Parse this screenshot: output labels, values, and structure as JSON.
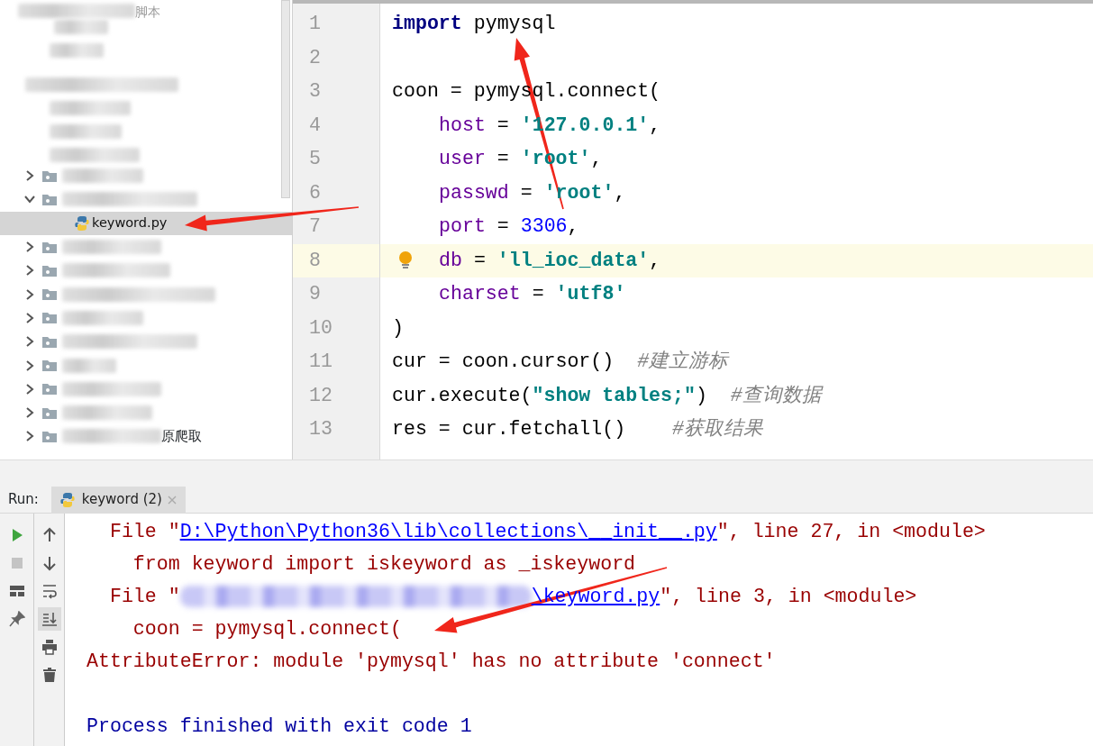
{
  "project_tree": {
    "top_label": "脚本",
    "items": [
      {
        "label_blurred": true,
        "expanded": false,
        "selected": false
      },
      {
        "label_blurred": true,
        "expanded": true,
        "selected": false,
        "children": [
          {
            "label": "keyword.py",
            "selected": true
          }
        ]
      },
      {
        "label_blurred": true,
        "expanded": false,
        "selected": false
      },
      {
        "label_blurred": true,
        "expanded": false,
        "selected": false
      },
      {
        "label_blurred": true,
        "expanded": false,
        "selected": false
      },
      {
        "label_blurred": true,
        "expanded": false,
        "selected": false
      },
      {
        "label_blurred": true,
        "expanded": false,
        "selected": false
      },
      {
        "label_blurred": true,
        "expanded": false,
        "selected": false
      },
      {
        "label_blurred": true,
        "expanded": false,
        "selected": false
      },
      {
        "label_blurred": true,
        "expanded": false,
        "selected": false
      },
      {
        "label_blurred": true,
        "label": "原爬取",
        "expanded": false,
        "selected": false
      }
    ]
  },
  "editor": {
    "lines": [
      {
        "number": "1",
        "current": false,
        "bulb": false,
        "indented": false,
        "tokens": [
          {
            "kind": "keyword",
            "text": "import"
          },
          {
            "kind": "plain",
            "text": " pymysql"
          }
        ]
      },
      {
        "number": "2",
        "current": false,
        "bulb": false
      },
      {
        "number": "3",
        "current": false,
        "bulb": false,
        "indented": false,
        "tokens": [
          {
            "kind": "plain",
            "text": "coon = pymysql.connect("
          }
        ]
      },
      {
        "number": "4",
        "current": false,
        "bulb": false,
        "indented": true,
        "tokens": [
          {
            "kind": "param",
            "text": "host"
          },
          {
            "kind": "plain",
            "text": " = "
          },
          {
            "kind": "string",
            "text": "'127.0.0.1'"
          },
          {
            "kind": "plain",
            "text": ","
          }
        ]
      },
      {
        "number": "5",
        "current": false,
        "bulb": false,
        "indented": true,
        "tokens": [
          {
            "kind": "param",
            "text": "user"
          },
          {
            "kind": "plain",
            "text": " = "
          },
          {
            "kind": "string",
            "text": "'root'"
          },
          {
            "kind": "plain",
            "text": ","
          }
        ]
      },
      {
        "number": "6",
        "current": false,
        "bulb": false,
        "indented": true,
        "tokens": [
          {
            "kind": "param",
            "text": "passwd"
          },
          {
            "kind": "plain",
            "text": " = "
          },
          {
            "kind": "string",
            "text": "'root'"
          },
          {
            "kind": "plain",
            "text": ","
          }
        ]
      },
      {
        "number": "7",
        "current": false,
        "bulb": false,
        "indented": true,
        "tokens": [
          {
            "kind": "param",
            "text": "port"
          },
          {
            "kind": "plain",
            "text": " = "
          },
          {
            "kind": "number",
            "text": "3306"
          },
          {
            "kind": "plain",
            "text": ","
          }
        ]
      },
      {
        "number": "8",
        "current": true,
        "bulb": true,
        "indented": true,
        "tokens": [
          {
            "kind": "param",
            "text": "db"
          },
          {
            "kind": "plain",
            "text": " = "
          },
          {
            "kind": "string",
            "text": "'ll_ioc_data'"
          },
          {
            "kind": "plain",
            "text": ","
          }
        ]
      },
      {
        "number": "9",
        "current": false,
        "bulb": false,
        "indented": true,
        "tokens": [
          {
            "kind": "param",
            "text": "charset"
          },
          {
            "kind": "plain",
            "text": " = "
          },
          {
            "kind": "string",
            "text": "'utf8'"
          }
        ]
      },
      {
        "number": "10",
        "current": false,
        "bulb": false,
        "indented": false,
        "tokens": [
          {
            "kind": "plain",
            "text": ")"
          }
        ]
      },
      {
        "number": "11",
        "current": false,
        "bulb": false,
        "indented": false,
        "tokens": [
          {
            "kind": "plain",
            "text": "cur = coon.cursor()  "
          },
          {
            "kind": "comment",
            "text": "#建立游标"
          }
        ]
      },
      {
        "number": "12",
        "current": false,
        "bulb": false,
        "indented": false,
        "tokens": [
          {
            "kind": "plain",
            "text": "cur.execute("
          },
          {
            "kind": "string",
            "text": "\"show tables;\""
          },
          {
            "kind": "plain",
            "text": ")  "
          },
          {
            "kind": "comment",
            "text": "#查询数据"
          }
        ]
      },
      {
        "number": "13",
        "current": false,
        "bulb": false,
        "indented": false,
        "tokens": [
          {
            "kind": "plain",
            "text": "res = cur.fetchall()    "
          },
          {
            "kind": "comment",
            "text": "#获取结果"
          }
        ]
      }
    ]
  },
  "run_panel": {
    "label": "Run:",
    "tabs": [
      {
        "title": "keyword (2)",
        "selected": true
      }
    ],
    "toolbar": [
      {
        "kind": "rerun",
        "selected": false
      },
      {
        "kind": "stop",
        "selected": false
      },
      {
        "kind": "layout",
        "selected": false
      },
      {
        "kind": "pin",
        "selected": false
      }
    ],
    "toolbar_2": [
      {
        "kind": "up",
        "selected": false
      },
      {
        "kind": "down",
        "selected": false
      },
      {
        "kind": "wrap",
        "selected": false
      },
      {
        "kind": "scroll-end",
        "selected": true
      },
      {
        "kind": "print",
        "selected": false
      },
      {
        "kind": "trash",
        "selected": false
      }
    ],
    "console": [
      {
        "kind": "error",
        "parts": [
          {
            "kind": "text",
            "text": "  File \""
          },
          {
            "kind": "link",
            "text": "D:\\Python\\Python36\\lib\\collections\\__init__.py"
          },
          {
            "kind": "text",
            "text": "\", line 27, in <module>"
          }
        ]
      },
      {
        "kind": "error",
        "parts": [
          {
            "kind": "text",
            "text": "    from keyword import iskeyword as _iskeyword"
          }
        ]
      },
      {
        "kind": "error",
        "parts": [
          {
            "kind": "text",
            "text": "  File \""
          },
          {
            "kind": "blurred"
          },
          {
            "kind": "link",
            "text": "\\keyword.py"
          },
          {
            "kind": "text",
            "text": "\", line 3, in <module>"
          }
        ]
      },
      {
        "kind": "error",
        "parts": [
          {
            "kind": "text",
            "text": "    coon = pymysql.connect("
          }
        ]
      },
      {
        "kind": "error",
        "parts": [
          {
            "kind": "text",
            "text": "AttributeError: module 'pymysql' has no attribute 'connect'"
          }
        ]
      },
      {
        "kind": "blank"
      },
      {
        "kind": "info",
        "parts": [
          {
            "kind": "text",
            "text": "Process finished with exit code 1"
          }
        ]
      }
    ]
  }
}
